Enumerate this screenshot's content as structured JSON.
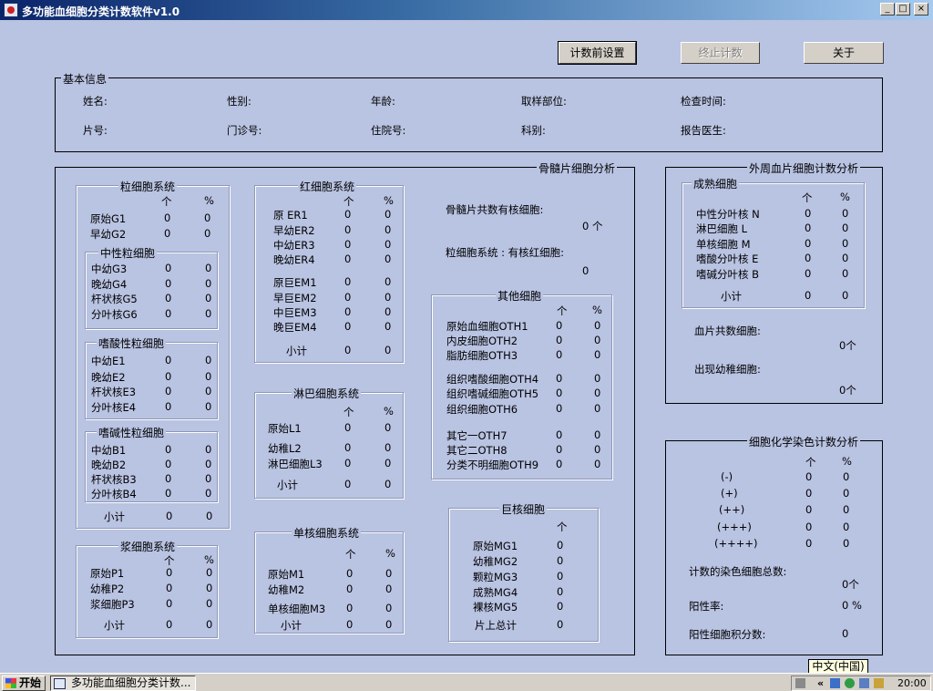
{
  "window": {
    "title": "多功能血细胞分类计数软件v1.0",
    "min": "_",
    "max": "□",
    "close": "×"
  },
  "toolbar": {
    "settings": "计数前设置",
    "stop": "终止计数",
    "about": "关于"
  },
  "basic": {
    "legend": "基本信息",
    "name": "姓名:",
    "sex": "性别:",
    "age": "年龄:",
    "site": "取样部位:",
    "time": "检查时间:",
    "slide": "片号:",
    "clinic": "门诊号:",
    "inpatient": "住院号:",
    "dept": "科别:",
    "doctor": "报告医生:"
  },
  "marrow": {
    "legend": "骨髓片细胞分析",
    "hdr_count": "个",
    "hdr_pct": "%",
    "granulo": {
      "legend": "粒细胞系统",
      "rows": [
        {
          "label": "原始G1",
          "n": "0",
          "p": "0"
        },
        {
          "label": "早幼G2",
          "n": "0",
          "p": "0"
        }
      ],
      "neutro": {
        "legend": "中性粒细胞",
        "rows": [
          {
            "label": "中幼G3",
            "n": "0",
            "p": "0"
          },
          {
            "label": "晚幼G4",
            "n": "0",
            "p": "0"
          },
          {
            "label": "杆状核G5",
            "n": "0",
            "p": "0"
          },
          {
            "label": "分叶核G6",
            "n": "0",
            "p": "0"
          }
        ]
      },
      "eosino": {
        "legend": "嗜酸性粒细胞",
        "rows": [
          {
            "label": "中幼E1",
            "n": "0",
            "p": "0"
          },
          {
            "label": "晚幼E2",
            "n": "0",
            "p": "0"
          },
          {
            "label": "杆状核E3",
            "n": "0",
            "p": "0"
          },
          {
            "label": "分叶核E4",
            "n": "0",
            "p": "0"
          }
        ]
      },
      "baso": {
        "legend": "嗜碱性粒细胞",
        "rows": [
          {
            "label": "中幼B1",
            "n": "0",
            "p": "0"
          },
          {
            "label": "晚幼B2",
            "n": "0",
            "p": "0"
          },
          {
            "label": "杆状核B3",
            "n": "0",
            "p": "0"
          },
          {
            "label": "分叶核B4",
            "n": "0",
            "p": "0"
          }
        ]
      },
      "subtotal": {
        "label": "小计",
        "n": "0",
        "p": "0"
      }
    },
    "plasma": {
      "legend": "浆细胞系统",
      "rows": [
        {
          "label": "原始P1",
          "n": "0",
          "p": "0"
        },
        {
          "label": "幼稚P2",
          "n": "0",
          "p": "0"
        },
        {
          "label": "浆细胞P3",
          "n": "0",
          "p": "0"
        }
      ],
      "subtotal": {
        "label": "小计",
        "n": "0",
        "p": "0"
      }
    },
    "erythro": {
      "legend": "红细胞系统",
      "rows": [
        {
          "label": "原  ER1",
          "n": "0",
          "p": "0"
        },
        {
          "label": "早幼ER2",
          "n": "0",
          "p": "0"
        },
        {
          "label": "中幼ER3",
          "n": "0",
          "p": "0"
        },
        {
          "label": "晚幼ER4",
          "n": "0",
          "p": "0"
        }
      ],
      "rows2": [
        {
          "label": "原巨EM1",
          "n": "0",
          "p": "0"
        },
        {
          "label": "早巨EM2",
          "n": "0",
          "p": "0"
        },
        {
          "label": "中巨EM3",
          "n": "0",
          "p": "0"
        },
        {
          "label": "晚巨EM4",
          "n": "0",
          "p": "0"
        }
      ],
      "subtotal": {
        "label": "小计",
        "n": "0",
        "p": "0"
      }
    },
    "lympho": {
      "legend": "淋巴细胞系统",
      "rows": [
        {
          "label": "原始L1",
          "n": "0",
          "p": "0"
        },
        {
          "label": "幼稚L2",
          "n": "0",
          "p": "0"
        },
        {
          "label": "淋巴细胞L3",
          "n": "0",
          "p": "0"
        }
      ],
      "subtotal": {
        "label": "小计",
        "n": "0",
        "p": "0"
      }
    },
    "mono": {
      "legend": "单核细胞系统",
      "rows": [
        {
          "label": "原始M1",
          "n": "0",
          "p": "0"
        },
        {
          "label": "幼稚M2",
          "n": "0",
          "p": "0"
        },
        {
          "label": "单核细胞M3",
          "n": "0",
          "p": "0"
        }
      ],
      "subtotal": {
        "label": "小计",
        "n": "0",
        "p": "0"
      }
    },
    "total_label": "骨髓片共数有核细胞:",
    "total_value": "0 个",
    "ratio_label": "粒细胞系统 : 有核红细胞:",
    "ratio_value": "0",
    "other": {
      "legend": "其他细胞",
      "rows": [
        {
          "label": "原始血细胞OTH1",
          "n": "0",
          "p": "0"
        },
        {
          "label": "内皮细胞OTH2",
          "n": "0",
          "p": "0"
        },
        {
          "label": "脂肪细胞OTH3",
          "n": "0",
          "p": "0"
        }
      ],
      "rows2": [
        {
          "label": "组织嗜酸细胞OTH4",
          "n": "0",
          "p": "0"
        },
        {
          "label": "组织嗜碱细胞OTH5",
          "n": "0",
          "p": "0"
        },
        {
          "label": "组织细胞OTH6",
          "n": "0",
          "p": "0"
        }
      ],
      "rows3": [
        {
          "label": "其它一OTH7",
          "n": "0",
          "p": "0"
        },
        {
          "label": "其它二OTH8",
          "n": "0",
          "p": "0"
        },
        {
          "label": "分类不明细胞OTH9",
          "n": "0",
          "p": "0"
        }
      ]
    },
    "mega": {
      "legend": "巨核细胞",
      "rows": [
        {
          "label": "原始MG1",
          "n": "0"
        },
        {
          "label": "幼稚MG2",
          "n": "0"
        },
        {
          "label": "颗粒MG3",
          "n": "0"
        },
        {
          "label": "成熟MG4",
          "n": "0"
        },
        {
          "label": "裸核MG5",
          "n": "0"
        }
      ],
      "subtotal": {
        "label": "片上总计",
        "n": "0"
      }
    }
  },
  "blood": {
    "legend": "外周血片细胞计数分析",
    "mature": {
      "legend": "成熟细胞",
      "rows": [
        {
          "label": "中性分叶核 N",
          "n": "0",
          "p": "0"
        },
        {
          "label": "淋巴细胞  L",
          "n": "0",
          "p": "0"
        },
        {
          "label": "单核细胞  M",
          "n": "0",
          "p": "0"
        },
        {
          "label": "嗜酸分叶核 E",
          "n": "0",
          "p": "0"
        },
        {
          "label": "嗜碱分叶核 B",
          "n": "0",
          "p": "0"
        }
      ],
      "subtotal": {
        "label": "小计",
        "n": "0",
        "p": "0"
      }
    },
    "total_label": "血片共数细胞:",
    "total_value": "0个",
    "immature_label": "出现幼稚细胞:",
    "immature_value": "0个"
  },
  "stain": {
    "legend": "细胞化学染色计数分析",
    "rows": [
      {
        "label": "(-)",
        "n": "0",
        "p": "0"
      },
      {
        "label": "(+)",
        "n": "0",
        "p": "0"
      },
      {
        "label": "(++)",
        "n": "0",
        "p": "0"
      },
      {
        "label": "(+++)",
        "n": "0",
        "p": "0"
      },
      {
        "label": "(++++)",
        "n": "0",
        "p": "0"
      }
    ],
    "total_label": "计数的染色细胞总数:",
    "total_value": "0个",
    "rate_label": "阳性率:",
    "rate_value": "0 %",
    "score_label": "阳性细胞积分数:",
    "score_value": "0"
  },
  "taskbar": {
    "start": "开始",
    "task": "多功能血细胞分类计数...",
    "ime": "中文(中国)",
    "clock": "20:00"
  }
}
